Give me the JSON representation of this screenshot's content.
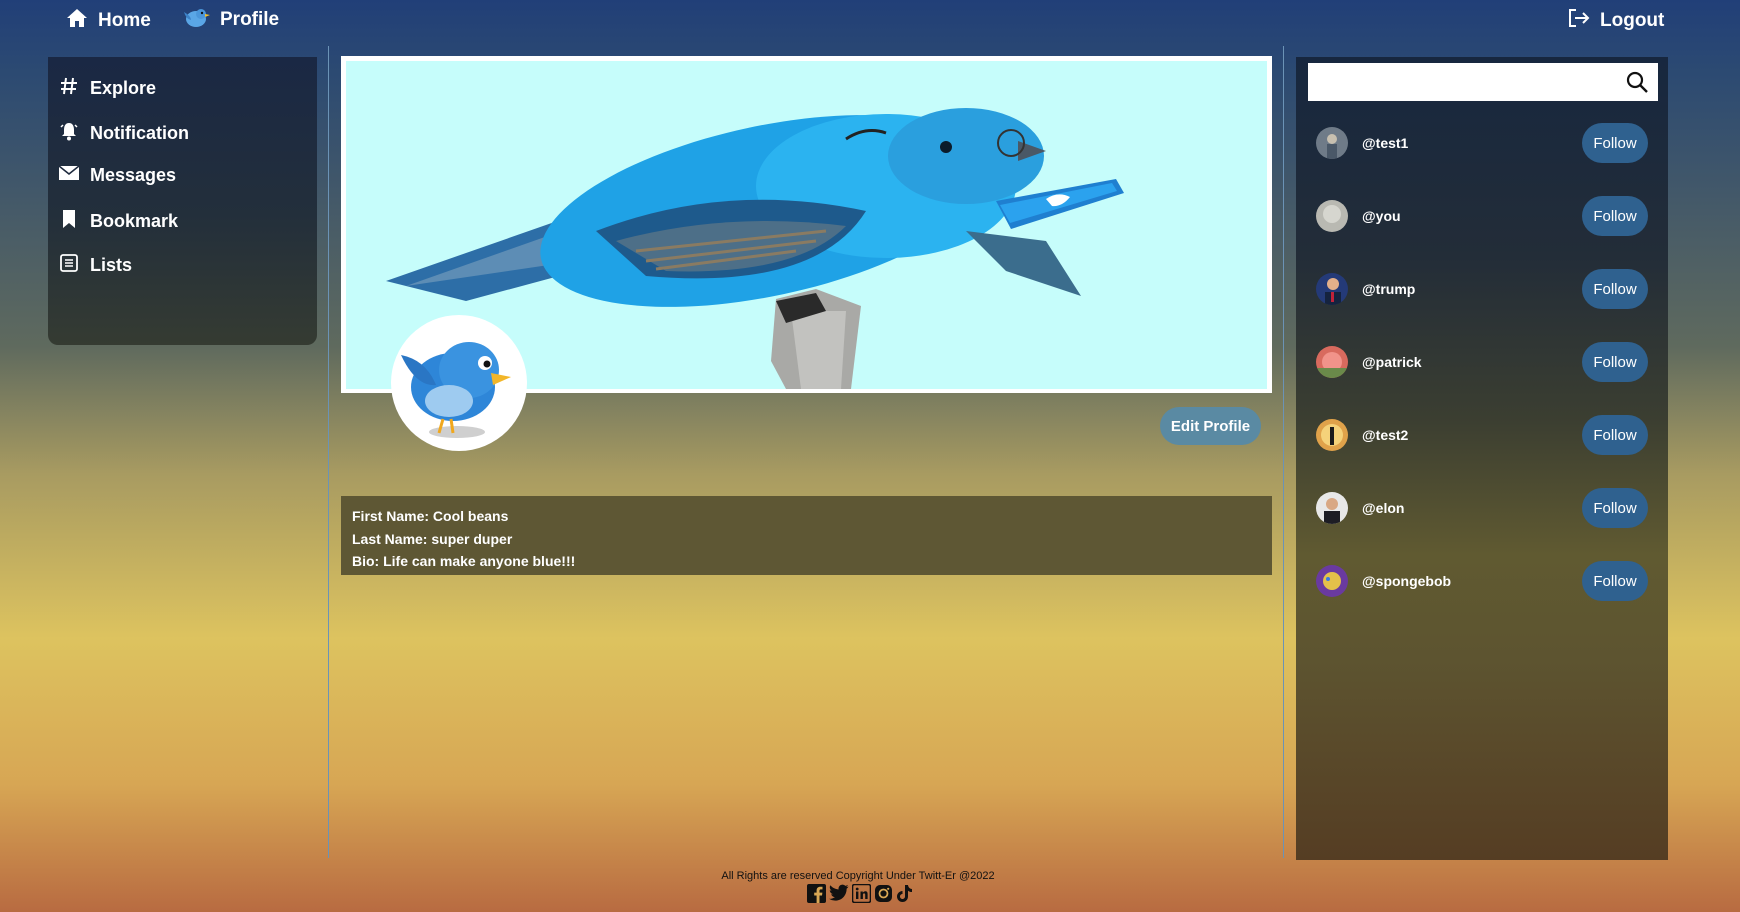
{
  "nav": {
    "home": "Home",
    "profile": "Profile",
    "logout": "Logout"
  },
  "sidebar": {
    "items": [
      {
        "label": "Explore",
        "icon": "hashtag-icon"
      },
      {
        "label": "Notification",
        "icon": "bell-icon"
      },
      {
        "label": "Messages",
        "icon": "envelope-icon"
      },
      {
        "label": "Bookmark",
        "icon": "bookmark-icon"
      },
      {
        "label": "Lists",
        "icon": "list-icon"
      }
    ]
  },
  "profile": {
    "edit_label": "Edit Profile",
    "first_name": "First Name: Cool beans",
    "last_name": "Last Name: super duper",
    "bio": "Bio: Life can make anyone blue!!!"
  },
  "search": {
    "placeholder": "",
    "value": ""
  },
  "suggestions": [
    {
      "handle": "@test1",
      "follow_label": "Follow",
      "avatar_color": "#6f7b88"
    },
    {
      "handle": "@you",
      "follow_label": "Follow",
      "avatar_color": "#b9b9b2"
    },
    {
      "handle": "@trump",
      "follow_label": "Follow",
      "avatar_color": "#243a78"
    },
    {
      "handle": "@patrick",
      "follow_label": "Follow",
      "avatar_color": "#d86a5e"
    },
    {
      "handle": "@test2",
      "follow_label": "Follow",
      "avatar_color": "#e0a24a"
    },
    {
      "handle": "@elon",
      "follow_label": "Follow",
      "avatar_color": "#2b2b33"
    },
    {
      "handle": "@spongebob",
      "follow_label": "Follow",
      "avatar_color": "#6a3aa0"
    }
  ],
  "footer": {
    "copyright": "All Rights are reserved Copyright Under Twitt-Er @2022"
  },
  "colors": {
    "accent": "#2f618f",
    "edit_button": "#5a8aa3",
    "info_box": "#5e5734",
    "banner_bg": "#c6fdfb"
  }
}
